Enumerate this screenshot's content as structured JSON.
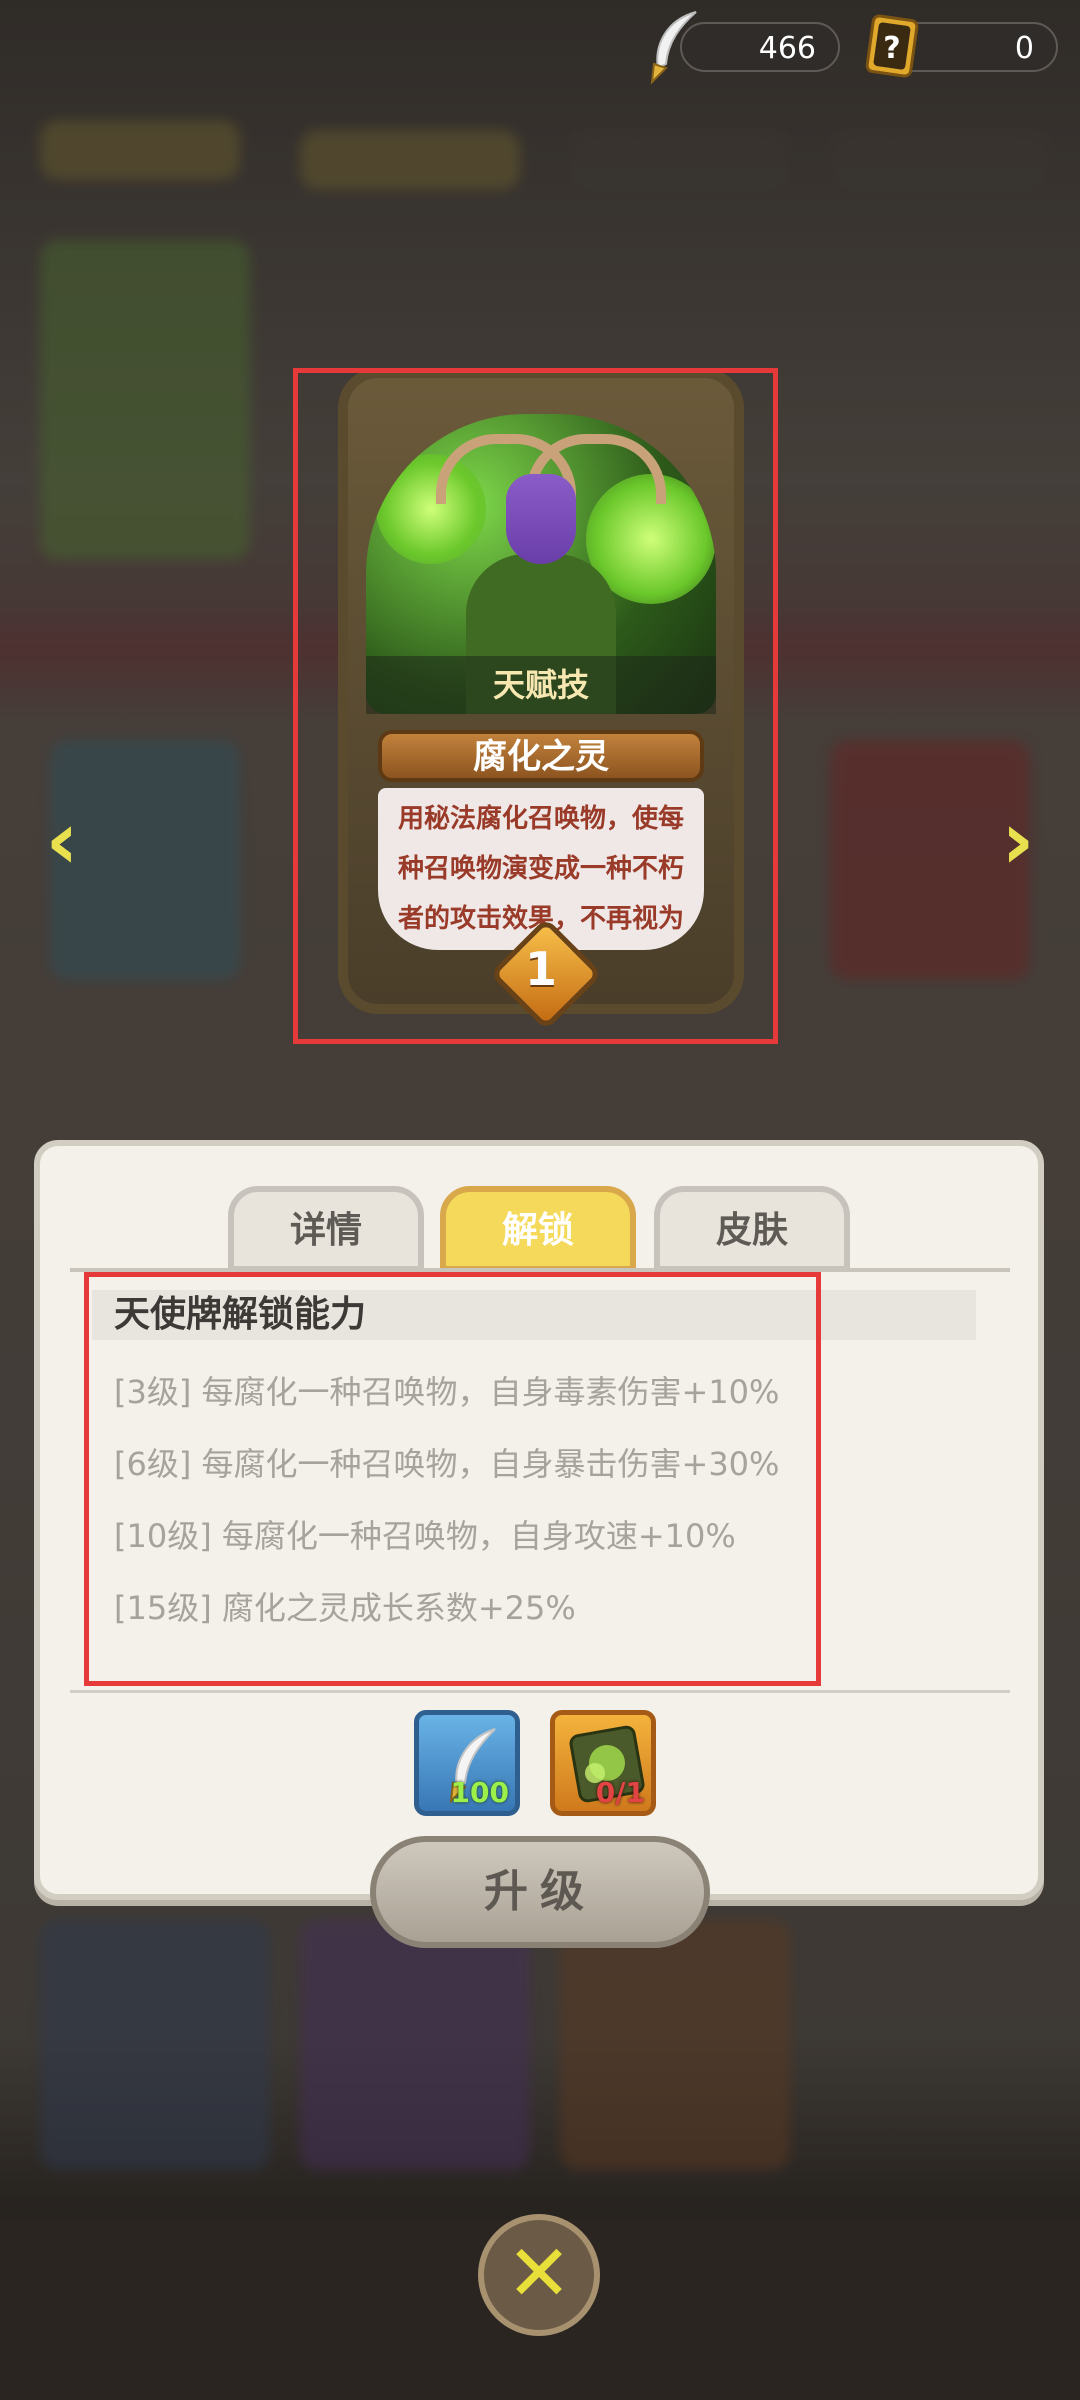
{
  "currency": {
    "feather": {
      "icon": "feather-icon",
      "value": "466"
    },
    "card": {
      "icon": "mystery-card-icon",
      "value": "0"
    }
  },
  "card": {
    "type_label": "天赋技",
    "name": "腐化之灵",
    "description": "用秘法腐化召唤物，使每种召唤物演变成一种不朽者的攻击效果，不再视为",
    "level": "1"
  },
  "navigation": {
    "prev_icon": "chevron-left-icon",
    "next_icon": "chevron-right-icon"
  },
  "tabs": [
    {
      "label": "详情",
      "active": false
    },
    {
      "label": "解锁",
      "active": true
    },
    {
      "label": "皮肤",
      "active": false
    }
  ],
  "unlock": {
    "title": "天使牌解锁能力",
    "abilities": [
      "[3级]  每腐化一种召唤物，自身毒素伤害+10%",
      "[6级]  每腐化一种召唤物，自身暴击伤害+30%",
      "[10级]  每腐化一种召唤物，自身攻速+10%",
      "[15级]  腐化之灵成长系数+25%"
    ]
  },
  "materials": [
    {
      "icon": "feather-icon",
      "count": "100"
    },
    {
      "icon": "card-book-icon",
      "count": "0/1"
    }
  ],
  "upgrade_button": "升级",
  "close_icon": "close-icon"
}
